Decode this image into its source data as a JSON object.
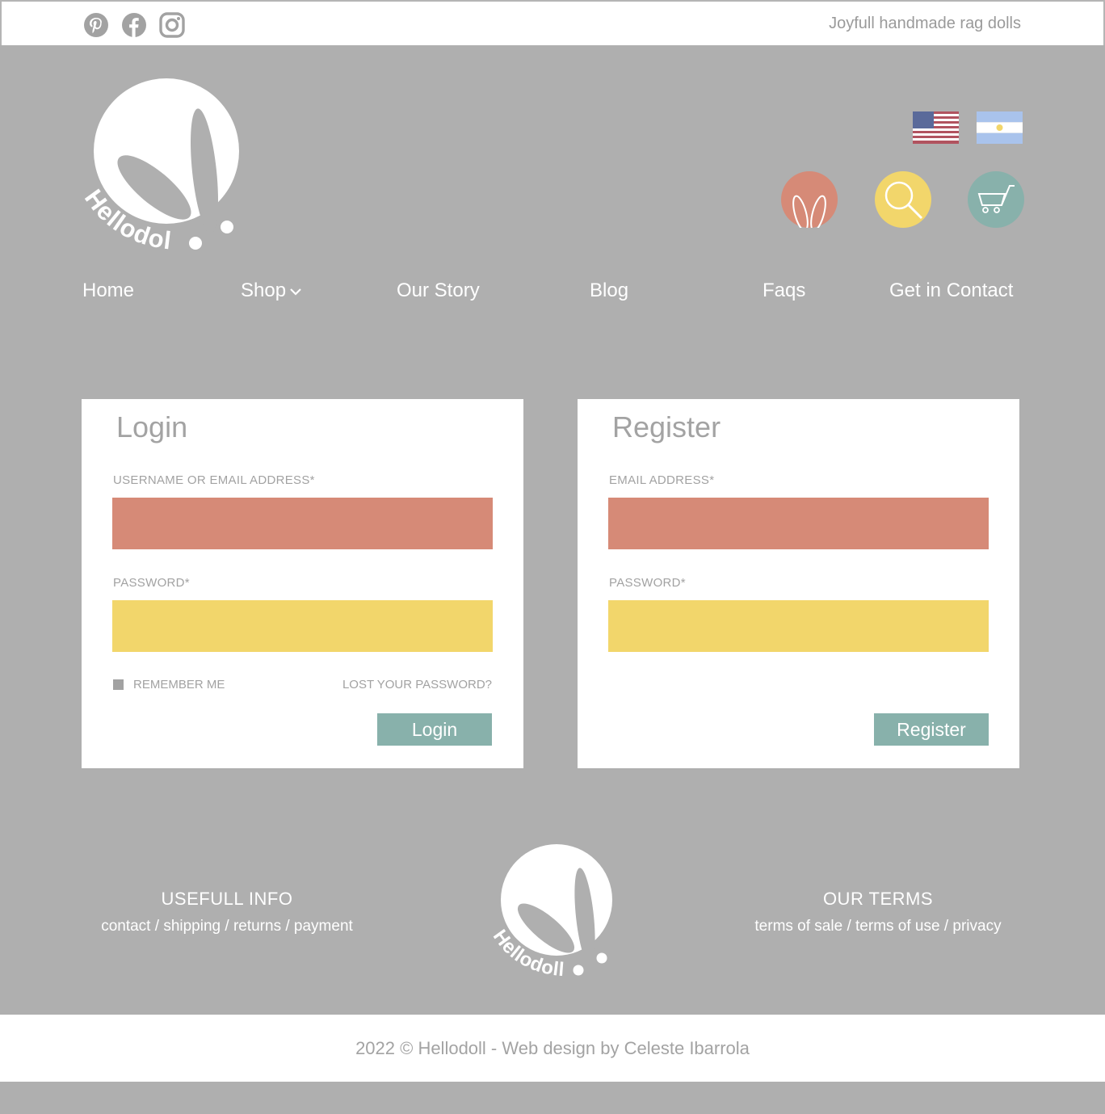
{
  "topbar": {
    "social_icons": [
      "pinterest-icon",
      "facebook-icon",
      "instagram-icon"
    ],
    "tagline": "Joyfull handmade rag dolls"
  },
  "header": {
    "logo_text": "Hellodoll",
    "flags": [
      "us-flag",
      "argentina-flag"
    ],
    "action_icons": [
      "bunny-ears-icon",
      "search-icon",
      "cart-icon"
    ],
    "colors": {
      "coral": "#d68a77",
      "yellow": "#f2d66b",
      "teal": "#88b1ab",
      "background": "#afafaf"
    }
  },
  "nav": {
    "home": "Home",
    "shop": "Shop",
    "our_story": "Our Story",
    "blog": "Blog",
    "faqs": "Faqs",
    "contact": "Get in Contact"
  },
  "login": {
    "title": "Login",
    "username_label": "USERNAME OR EMAIL ADDRESS*",
    "password_label": "PASSWORD*",
    "remember_label": "REMEMBER ME",
    "lost_password": "LOST YOUR PASSWORD?",
    "button": "Login"
  },
  "register": {
    "title": "Register",
    "email_label": "EMAIL ADDRESS*",
    "password_label": "PASSWORD*",
    "button": "Register"
  },
  "footer": {
    "left_title": "USEFULL INFO",
    "left_links": [
      "contact",
      "shipping",
      "returns",
      "payment"
    ],
    "right_title": "OUR TERMS",
    "right_links": [
      "terms of sale",
      "terms of use",
      "privacy"
    ],
    "separator": " / ",
    "copyright": "2022 © Hellodoll - Web design by Celeste Ibarrola"
  }
}
